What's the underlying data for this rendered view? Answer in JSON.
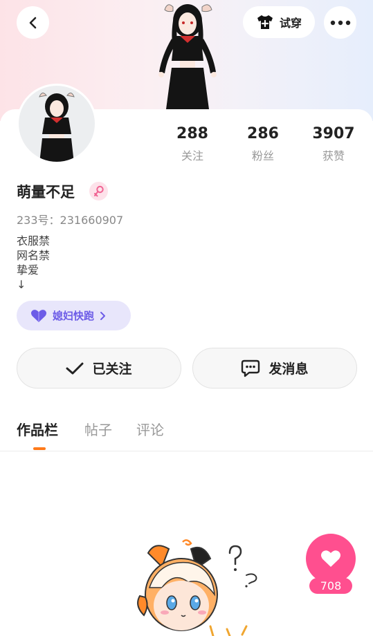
{
  "header": {
    "tryon_label": "试穿"
  },
  "profile": {
    "username": "萌量不足",
    "uid_label": "233号：",
    "uid_value": "231660907",
    "bio_lines": [
      "衣服禁",
      "网名禁",
      "挚爱",
      "↓"
    ],
    "family_label": "媳妇快跑"
  },
  "stats": [
    {
      "value": "288",
      "label": "关注"
    },
    {
      "value": "286",
      "label": "粉丝"
    },
    {
      "value": "3907",
      "label": "获赞"
    }
  ],
  "actions": {
    "followed_label": "已关注",
    "message_label": "发消息"
  },
  "tabs": [
    {
      "label": "作品栏",
      "active": true
    },
    {
      "label": "帖子",
      "active": false
    },
    {
      "label": "评论",
      "active": false
    }
  ],
  "like": {
    "count": "708"
  },
  "colors": {
    "accent_orange": "#ff7a1a",
    "like_pink": "#ff4f8f",
    "family_purple": "#6c5ce7",
    "gender_pink": "#f06292"
  },
  "icons": {
    "back": "chevron-left-icon",
    "tryon": "tshirt-icon",
    "more": "more-dots-icon",
    "gender": "female-icon",
    "family": "heart-icon",
    "follow": "checkmark-icon",
    "message": "chat-bubble-icon",
    "like": "heart-icon"
  }
}
